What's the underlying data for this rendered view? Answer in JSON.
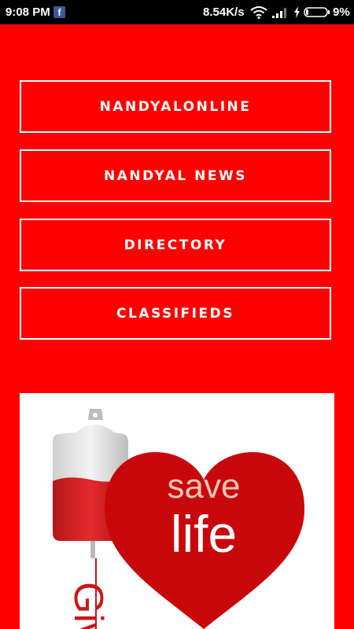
{
  "status_bar": {
    "time": "9:08 PM",
    "fb_icon_letter": "f",
    "network_speed": "8.54K/s",
    "battery_percent": "9%",
    "icons": [
      "facebook-notification-icon",
      "wifi-icon",
      "signal-icon",
      "charging-icon",
      "battery-icon"
    ]
  },
  "menu": {
    "items": [
      {
        "label": "NANDYALONLINE"
      },
      {
        "label": "NANDYAL NEWS"
      },
      {
        "label": "DIRECTORY"
      },
      {
        "label": "CLASSIFIEDS"
      }
    ]
  },
  "banner": {
    "line1": "save",
    "line2": "life",
    "partial_text": "Giv"
  },
  "colors": {
    "background": "#ff0000",
    "heart": "#c8070b",
    "status_bar": "#000000"
  }
}
